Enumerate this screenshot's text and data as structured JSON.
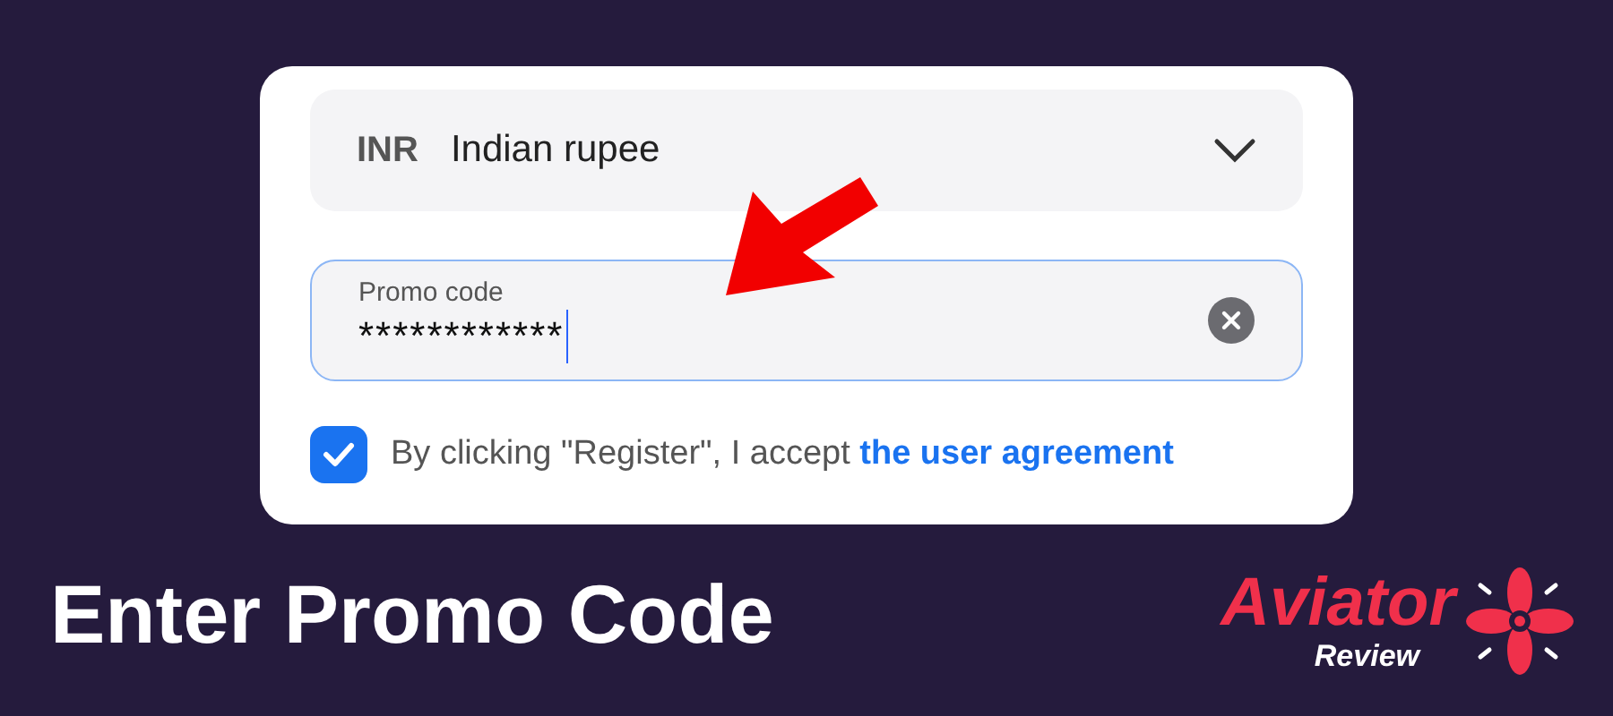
{
  "currency": {
    "code": "INR",
    "name": "Indian rupee"
  },
  "promo_field": {
    "label": "Promo code",
    "value": "************"
  },
  "agreement": {
    "checked": true,
    "text": "By clicking \"Register\", I accept ",
    "link": "the user agreement"
  },
  "headline": "Enter Promo Code",
  "logo": {
    "title": "Aviator",
    "subtitle": "Review"
  }
}
